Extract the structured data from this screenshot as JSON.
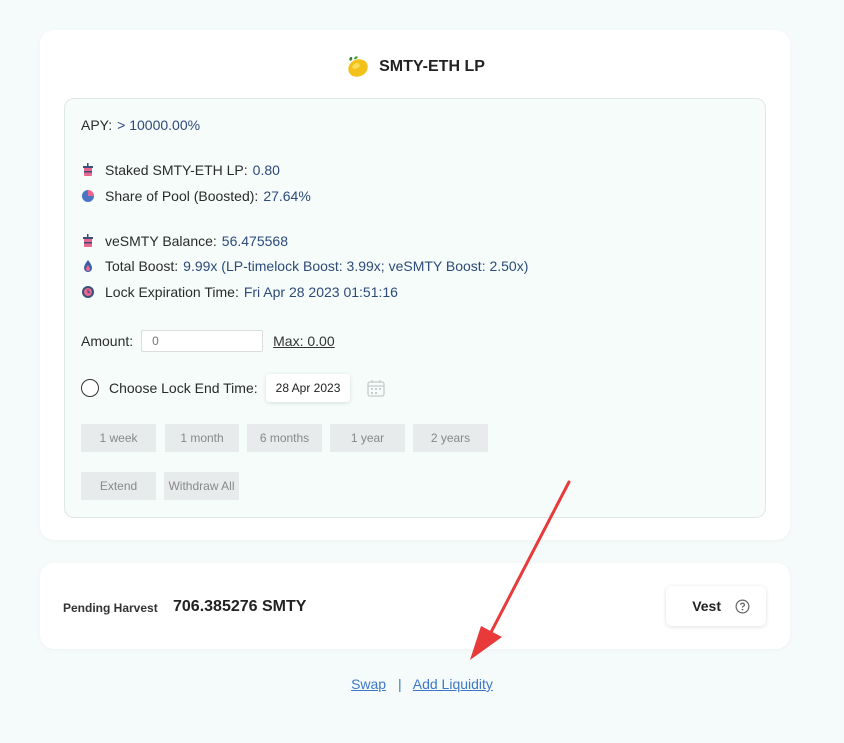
{
  "pool": {
    "title": "SMTY-ETH LP",
    "apy_label": "APY:",
    "apy_value": "> 10000.00%",
    "staked_label": "Staked SMTY-ETH LP:",
    "staked_value": "0.80",
    "share_label": "Share of Pool (Boosted):",
    "share_value": "27.64%",
    "vesmty_label": "veSMTY Balance:",
    "vesmty_value": "56.475568",
    "boost_label": "Total Boost:",
    "boost_value": "9.99x (LP-timelock Boost: 3.99x; veSMTY Boost: 2.50x)",
    "lock_label": "Lock Expiration Time:",
    "lock_value": "Fri Apr 28 2023 01:51:16"
  },
  "form": {
    "amount_label": "Amount:",
    "amount_placeholder": "0",
    "max_label": "Max: 0.00",
    "lock_end_label": "Choose Lock End Time:",
    "lock_end_date": "28 Apr 2023",
    "durations": [
      "1 week",
      "1 month",
      "6 months",
      "1 year",
      "2 years"
    ],
    "extend_label": "Extend",
    "withdraw_label": "Withdraw All"
  },
  "harvest": {
    "pending_label": "Pending Harvest",
    "pending_value": "706.385276 SMTY",
    "vest_label": "Vest"
  },
  "footer": {
    "swap_label": "Swap",
    "separator": "|",
    "add_liquidity_label": "Add Liquidity"
  },
  "colors": {
    "value_text": "#2d4a7a",
    "link": "#3f77c8",
    "arrow": "#e83a3a",
    "button_bg": "#e8ebec"
  }
}
